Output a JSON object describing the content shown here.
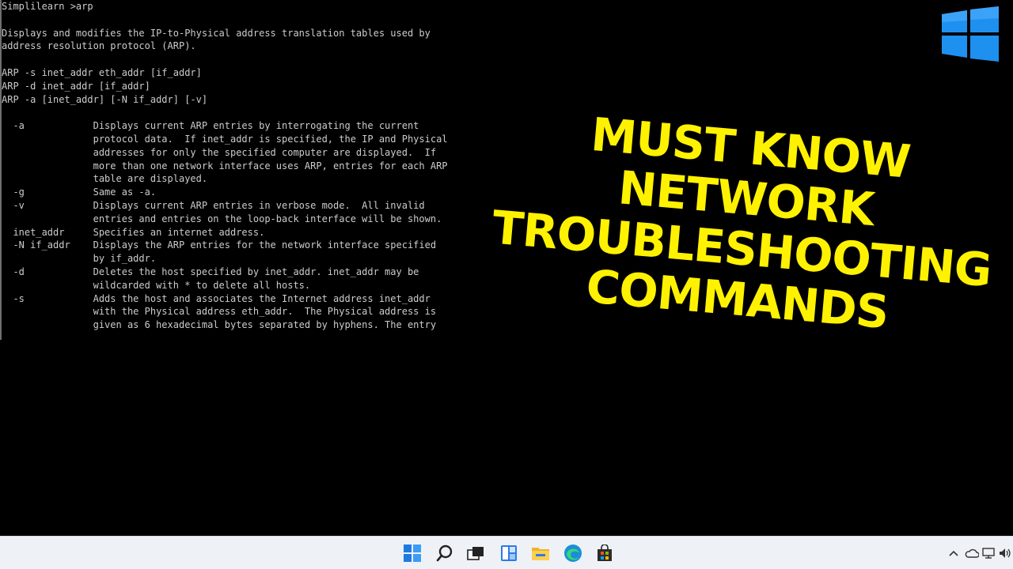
{
  "terminal": {
    "lines": [
      "Simplilearn >arp",
      "",
      "Displays and modifies the IP-to-Physical address translation tables used by",
      "address resolution protocol (ARP).",
      "",
      "ARP -s inet_addr eth_addr [if_addr]",
      "ARP -d inet_addr [if_addr]",
      "ARP -a [inet_addr] [-N if_addr] [-v]",
      "",
      "  -a            Displays current ARP entries by interrogating the current",
      "                protocol data.  If inet_addr is specified, the IP and Physical",
      "                addresses for only the specified computer are displayed.  If",
      "                more than one network interface uses ARP, entries for each ARP",
      "                table are displayed.",
      "  -g            Same as -a.",
      "  -v            Displays current ARP entries in verbose mode.  All invalid",
      "                entries and entries on the loop-back interface will be shown.",
      "  inet_addr     Specifies an internet address.",
      "  -N if_addr    Displays the ARP entries for the network interface specified",
      "                by if_addr.",
      "  -d            Deletes the host specified by inet_addr. inet_addr may be",
      "                wildcarded with * to delete all hosts.",
      "  -s            Adds the host and associates the Internet address inet_addr",
      "                with the Physical address eth_addr.  The Physical address is",
      "                given as 6 hexadecimal bytes separated by hyphens. The entry"
    ]
  },
  "headline": {
    "lines": [
      "MUST KNOW",
      "NETWORK",
      "TROUBLESHOOTING",
      "COMMANDS"
    ]
  },
  "logo": {
    "icon": "windows-logo-icon",
    "color": "#1e90f0"
  },
  "taskbar": {
    "icons": [
      "windows-start-icon",
      "search-icon",
      "task-view-icon",
      "widgets-icon",
      "file-explorer-icon",
      "edge-browser-icon",
      "store-icon"
    ],
    "tray": [
      "chevron-up-icon",
      "onedrive-cloud-icon",
      "network-icon",
      "volume-icon"
    ]
  },
  "colors": {
    "headline": "#fff200",
    "terminal_text": "#cccccc",
    "background": "#000000",
    "taskbar": "#eef1f6"
  }
}
